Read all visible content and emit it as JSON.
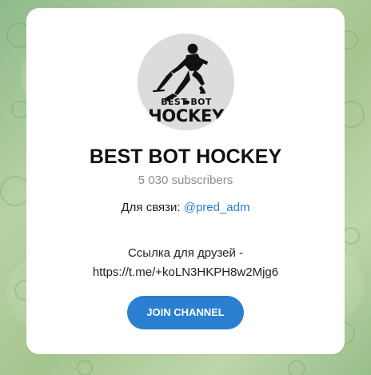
{
  "card": {
    "title": "BEST BOT HOCKEY",
    "subscribers": "5 030 subscribers",
    "contact_label": "Для связи: ",
    "contact_handle": "@pred_adm",
    "friends_label": "Ссылка для друзей -",
    "friends_link": "https://t.me/+koLN3HKPH8w2Mjg6",
    "join_button_label": "JOIN CHANNEL"
  },
  "logo": {
    "top_text": "BEST   BOT",
    "main_text": "HOCKEY",
    "icon": "hockey-player-logo"
  },
  "colors": {
    "accent": "#2b7fd0",
    "link": "#2a7fd2",
    "title": "#111111",
    "muted": "#8b8b8b",
    "card_bg": "#ffffff",
    "background": "#a9c89a"
  }
}
